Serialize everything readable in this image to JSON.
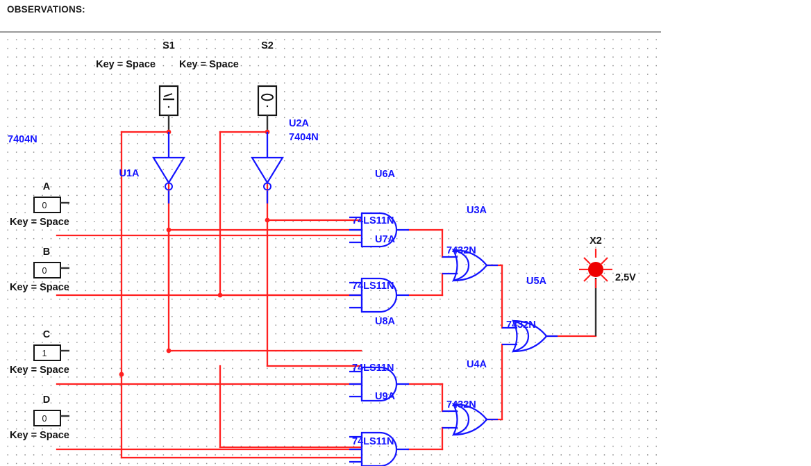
{
  "page": {
    "heading": "OBSERVATIONS:"
  },
  "colors": {
    "wire_red": "#ff2020",
    "wire_blue": "#1414ff",
    "wire_black": "#333333",
    "label_blue": "#1414ff",
    "label_black": "#141414",
    "lamp_red": "#ee0000",
    "grid_dot": "#8c8c8c",
    "rule": "#999999"
  },
  "switches_top": [
    {
      "ref": "S1",
      "key_label": "Key = Space",
      "symbol": "spst-switch-closed-icon"
    },
    {
      "ref": "S2",
      "key_label": "Key = Space",
      "symbol": "spst-switch-open-icon"
    }
  ],
  "inverters": [
    {
      "ref": "U1A",
      "part": "7404N",
      "part_side": "left"
    },
    {
      "ref": "U2A",
      "part": "7404N",
      "part_side": "right"
    }
  ],
  "inputs": [
    {
      "name": "A",
      "value": "0",
      "key_label": "Key = Space"
    },
    {
      "name": "B",
      "value": "0",
      "key_label": "Key = Space"
    },
    {
      "name": "C",
      "value": "1",
      "key_label": "Key = Space"
    },
    {
      "name": "D",
      "value": "0",
      "key_label": "Key = Space"
    }
  ],
  "and_gates": [
    {
      "ref": "U6A",
      "part": "74LS11N",
      "inputs": 3
    },
    {
      "ref": "U7A",
      "part": "74LS11N",
      "inputs": 3
    },
    {
      "ref": "U8A",
      "part": "74LS11N",
      "inputs": 3
    },
    {
      "ref": "U9A",
      "part": "74LS11N",
      "inputs": 3
    }
  ],
  "or_gates": [
    {
      "ref": "U3A",
      "part": "7432N",
      "inputs": 2
    },
    {
      "ref": "U4A",
      "part": "7432N",
      "inputs": 2
    },
    {
      "ref": "U5A",
      "part": "7432N",
      "inputs": 2
    }
  ],
  "lamp": {
    "ref": "X2",
    "rating": "2.5V",
    "state": "on"
  }
}
